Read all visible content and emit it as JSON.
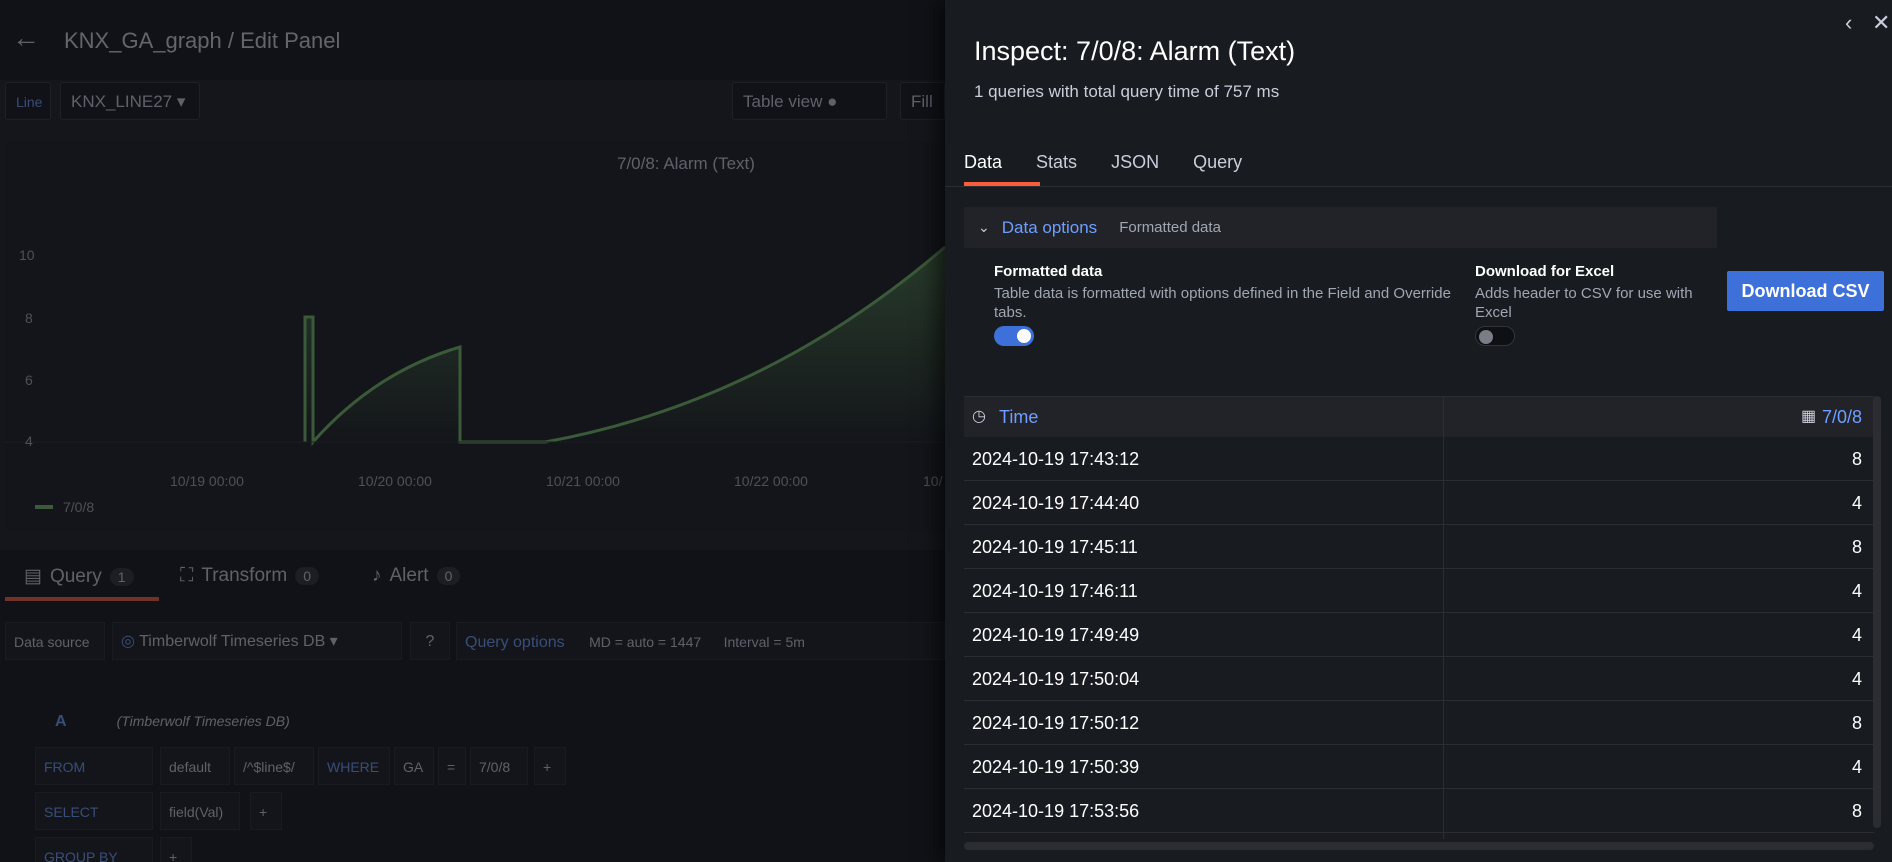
{
  "editor": {
    "title": "KNX_GA_graph / Edit Panel",
    "line_label": "Line",
    "line_value": "KNX_LINE27",
    "table_view_label": "Table view",
    "fill_label": "Fill",
    "legend_series": "7/0/8",
    "chart_title": "7/0/8: Alarm (Text)"
  },
  "chart_data": {
    "type": "area",
    "title": "7/0/8: Alarm (Text)",
    "x_tick_labels": [
      "10/19 00:00",
      "10/20 00:00",
      "10/21 00:00",
      "10/22 00:00",
      "10/"
    ],
    "y_tick_labels": [
      "10",
      "8",
      "6",
      "4"
    ],
    "ylim": [
      3,
      11
    ],
    "series": [
      {
        "name": "7/0/8",
        "color": "#73bf69"
      }
    ]
  },
  "query_tabs": [
    {
      "label": "Query",
      "count": "1"
    },
    {
      "label": "Transform",
      "count": "0"
    },
    {
      "label": "Alert",
      "count": "0"
    }
  ],
  "datasource": {
    "label": "Data source",
    "name": "Timberwolf Timeseries DB",
    "query_options": "Query options",
    "md": "MD = auto = 1447",
    "interval": "Interval = 5m"
  },
  "query_builder": {
    "letter": "A",
    "db": "(Timberwolf Timeseries DB)",
    "from": "FROM",
    "default": "default",
    "line": "/^$line$/",
    "where": "WHERE",
    "ga": "GA",
    "eq": "=",
    "ga_value": "7/0/8",
    "plus": "+",
    "select": "SELECT",
    "field": "field(Val)",
    "group_by": "GROUP BY"
  },
  "inspect": {
    "title": "Inspect: 7/0/8: Alarm (Text)",
    "subtitle": "1 queries with total query time of 757 ms",
    "tabs": [
      "Data",
      "Stats",
      "JSON",
      "Query"
    ],
    "data_options": "Data options",
    "data_options_summary": "Formatted data",
    "formatted_label": "Formatted data",
    "formatted_desc": "Table data is formatted with options defined in the Field and Override tabs.",
    "formatted_on": true,
    "excel_label": "Download for Excel",
    "excel_desc": "Adds header to CSV for use with Excel",
    "excel_on": false,
    "download_label": "Download CSV",
    "columns": [
      "Time",
      "7/0/8"
    ],
    "rows": [
      [
        "2024-10-19 17:43:12",
        "8"
      ],
      [
        "2024-10-19 17:44:40",
        "4"
      ],
      [
        "2024-10-19 17:45:11",
        "8"
      ],
      [
        "2024-10-19 17:46:11",
        "4"
      ],
      [
        "2024-10-19 17:49:49",
        "4"
      ],
      [
        "2024-10-19 17:50:04",
        "4"
      ],
      [
        "2024-10-19 17:50:12",
        "8"
      ],
      [
        "2024-10-19 17:50:39",
        "4"
      ],
      [
        "2024-10-19 17:53:56",
        "8"
      ]
    ]
  }
}
